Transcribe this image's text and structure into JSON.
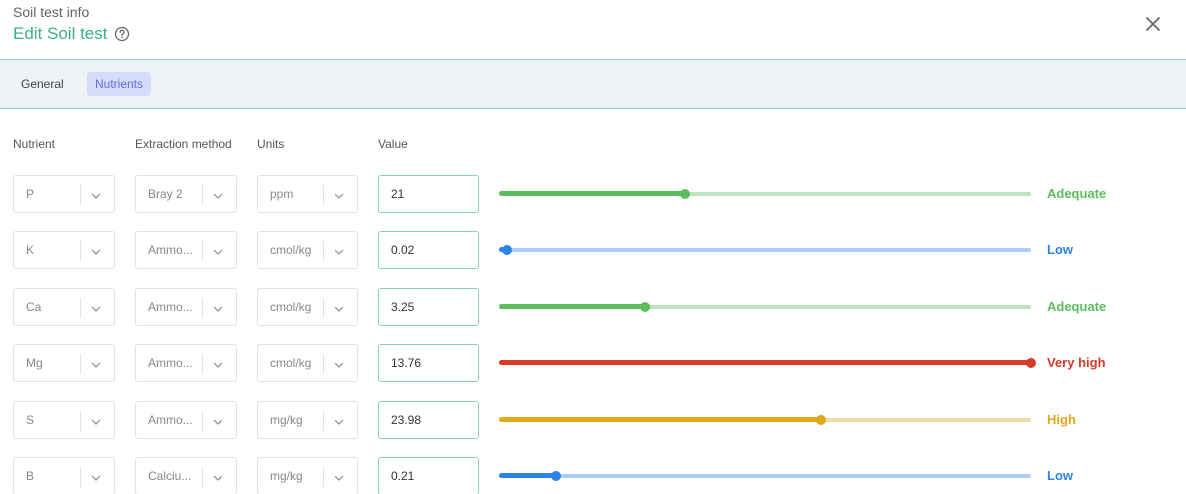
{
  "header": {
    "subtitle": "Soil test info",
    "title": "Edit Soil test",
    "help_icon": "question-circle-icon",
    "close_icon": "close-icon"
  },
  "tabs": [
    {
      "label": "General",
      "active": false
    },
    {
      "label": "Nutrients",
      "active": true
    }
  ],
  "columns": {
    "nutrient": "Nutrient",
    "extraction": "Extraction method",
    "units": "Units",
    "value": "Value"
  },
  "colors": {
    "accent": "#3aae8c",
    "adequate": "#5bbd5b",
    "low": "#2c84e8",
    "very_high": "#d73a26",
    "high": "#e0a61c"
  },
  "rows": [
    {
      "nutrient": "P",
      "extraction": "Bray 2",
      "units": "ppm",
      "value": "21",
      "level": 0.35,
      "status": "Adequate",
      "status_key": "adequate"
    },
    {
      "nutrient": "K",
      "extraction": "Ammo...",
      "units": "cmol/kg",
      "value": "0.02",
      "level": 0.015,
      "status": "Low",
      "status_key": "low"
    },
    {
      "nutrient": "Ca",
      "extraction": "Ammo...",
      "units": "cmol/kg",
      "value": "3.25",
      "level": 0.275,
      "status": "Adequate",
      "status_key": "adequate"
    },
    {
      "nutrient": "Mg",
      "extraction": "Ammo...",
      "units": "cmol/kg",
      "value": "13.76",
      "level": 1.0,
      "status": "Very high",
      "status_key": "very_high"
    },
    {
      "nutrient": "S",
      "extraction": "Ammo...",
      "units": "mg/kg",
      "value": "23.98",
      "level": 0.605,
      "status": "High",
      "status_key": "high"
    },
    {
      "nutrient": "B",
      "extraction": "Calciu...",
      "units": "mg/kg",
      "value": "0.21",
      "level": 0.108,
      "status": "Low",
      "status_key": "low"
    }
  ]
}
